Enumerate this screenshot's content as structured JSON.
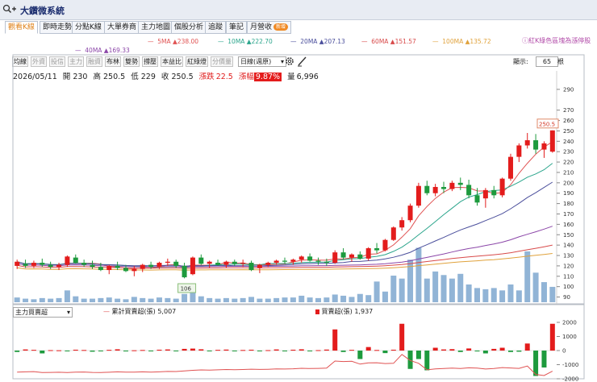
{
  "window": {
    "title": "大鑽微系統"
  },
  "tabs": [
    {
      "label": "觀看K線",
      "active": true
    },
    {
      "label": "即時走勢"
    },
    {
      "label": "分點K線"
    },
    {
      "label": "大單券商"
    },
    {
      "label": "主力地圖"
    },
    {
      "label": "個股分析"
    },
    {
      "label": "追蹤"
    },
    {
      "label": "筆記"
    },
    {
      "label": "月營收",
      "badge": "新增"
    }
  ],
  "ma_legend": [
    {
      "label": "5MA ▲238.00",
      "color": "#e05252"
    },
    {
      "label": "10MA ▲222.70",
      "color": "#2ba58c"
    },
    {
      "label": "20MA ▲207.13",
      "color": "#4b4f9c"
    },
    {
      "label": "60MA ▲151.57",
      "color": "#d84a4a"
    },
    {
      "label": "100MA ▲135.72",
      "color": "#e0a23c"
    },
    {
      "label": "40MA ▲169.33",
      "color": "#8b46a8"
    }
  ],
  "note": "ⓘ紅K綠色區塊為漲停股",
  "toolbar": {
    "buttons": [
      {
        "label": "均線"
      },
      {
        "label": "外資",
        "disabled": true
      },
      {
        "label": "投信",
        "disabled": true
      },
      {
        "label": "主力",
        "disabled": true
      },
      {
        "label": "融資",
        "disabled": true
      },
      {
        "label": "布林"
      },
      {
        "label": "雙勢"
      },
      {
        "label": "撐壓"
      },
      {
        "label": "本益比"
      },
      {
        "label": "紅綠燈"
      },
      {
        "label": "分價量",
        "disabled": true
      }
    ],
    "period_select": "日線(週原)",
    "display_label": "顯示:",
    "display_value": "65",
    "display_unit": "根"
  },
  "ohlc": {
    "date": "2026/05/11",
    "open": "開 230",
    "high": "高 250.5",
    "low": "低 229",
    "close": "收 250.5",
    "change_label": "漲跌",
    "change": "22.5",
    "pct_label": "漲幅",
    "pct": "9.87%",
    "vol_label": "量",
    "vol": "6,996"
  },
  "price_axis": [
    "290",
    "270",
    "260",
    "250",
    "240",
    "230",
    "220",
    "210",
    "200",
    "190",
    "180",
    "170",
    "160",
    "150",
    "140",
    "130",
    "120",
    "110",
    "100",
    "90"
  ],
  "last_price_tag": "250.5",
  "low_marker": "106",
  "indicator": {
    "select": "主力買賣超",
    "cum_label": "累計買賣超(張)",
    "cum_value": "5,007",
    "bar_label": "買賣超(張)",
    "bar_value": "1,937",
    "axis": [
      "2000",
      "1000",
      "0",
      "-1000",
      "-2000"
    ]
  },
  "chart_data": {
    "type": "candlestick",
    "ylim": [
      85,
      300
    ],
    "bars": 65,
    "ohlc": [
      [
        120,
        126,
        117,
        124
      ],
      [
        122,
        126,
        118,
        120
      ],
      [
        120,
        125,
        118,
        123
      ],
      [
        123,
        127,
        119,
        121
      ],
      [
        121,
        124,
        117,
        119
      ],
      [
        119,
        123,
        116,
        121
      ],
      [
        121,
        130,
        119,
        129
      ],
      [
        128,
        131,
        122,
        123
      ],
      [
        123,
        126,
        119,
        121
      ],
      [
        121,
        125,
        117,
        119
      ],
      [
        119,
        123,
        115,
        116
      ],
      [
        116,
        121,
        112,
        120
      ],
      [
        120,
        124,
        116,
        118
      ],
      [
        118,
        121,
        114,
        115
      ],
      [
        115,
        120,
        110,
        117
      ],
      [
        117,
        122,
        114,
        121
      ],
      [
        121,
        124,
        117,
        119
      ],
      [
        119,
        124,
        117,
        123
      ],
      [
        123,
        127,
        120,
        124
      ],
      [
        124,
        126,
        118,
        120
      ],
      [
        120,
        123,
        108,
        109
      ],
      [
        112,
        129,
        111,
        128
      ],
      [
        128,
        131,
        121,
        122
      ],
      [
        122,
        125,
        118,
        124
      ],
      [
        123,
        126,
        120,
        121
      ],
      [
        121,
        125,
        118,
        124
      ],
      [
        124,
        126,
        120,
        122
      ],
      [
        122,
        126,
        119,
        123
      ],
      [
        123,
        125,
        115,
        116
      ],
      [
        118,
        122,
        113,
        121
      ],
      [
        121,
        124,
        119,
        123
      ],
      [
        123,
        126,
        121,
        125
      ],
      [
        125,
        128,
        122,
        124
      ],
      [
        124,
        127,
        121,
        126
      ],
      [
        126,
        130,
        123,
        129
      ],
      [
        129,
        132,
        124,
        125
      ],
      [
        125,
        128,
        121,
        124
      ],
      [
        124,
        127,
        120,
        123
      ],
      [
        123,
        135,
        122,
        133
      ],
      [
        133,
        137,
        126,
        128
      ],
      [
        128,
        132,
        124,
        131
      ],
      [
        131,
        134,
        126,
        127
      ],
      [
        127,
        138,
        125,
        137
      ],
      [
        137,
        142,
        132,
        135
      ],
      [
        135,
        146,
        134,
        145
      ],
      [
        145,
        158,
        144,
        157
      ],
      [
        157,
        167,
        154,
        164
      ],
      [
        164,
        180,
        162,
        178
      ],
      [
        178,
        200,
        176,
        197
      ],
      [
        197,
        202,
        188,
        190
      ],
      [
        190,
        199,
        187,
        196
      ],
      [
        196,
        201,
        190,
        194
      ],
      [
        194,
        202,
        192,
        200
      ],
      [
        200,
        205,
        193,
        198
      ],
      [
        198,
        203,
        185,
        188
      ],
      [
        188,
        195,
        178,
        181
      ],
      [
        185,
        195,
        176,
        193
      ],
      [
        193,
        197,
        185,
        188
      ],
      [
        188,
        205,
        186,
        204
      ],
      [
        204,
        228,
        202,
        225
      ],
      [
        225,
        238,
        220,
        236
      ],
      [
        236,
        248,
        233,
        241
      ],
      [
        241,
        247,
        228,
        232
      ],
      [
        232,
        240,
        224,
        238
      ],
      [
        230,
        250.5,
        229,
        250.5
      ]
    ],
    "volume_scale_max": 120,
    "volume": [
      8,
      6,
      5,
      7,
      6,
      7,
      20,
      10,
      6,
      6,
      7,
      8,
      6,
      5,
      9,
      7,
      6,
      8,
      7,
      6,
      14,
      28,
      10,
      7,
      6,
      7,
      6,
      7,
      9,
      6,
      6,
      7,
      8,
      8,
      11,
      8,
      7,
      8,
      13,
      11,
      9,
      14,
      12,
      35,
      18,
      45,
      40,
      72,
      92,
      40,
      52,
      46,
      40,
      48,
      30,
      24,
      22,
      24,
      20,
      30,
      20,
      86,
      50,
      34,
      26
    ]
  }
}
